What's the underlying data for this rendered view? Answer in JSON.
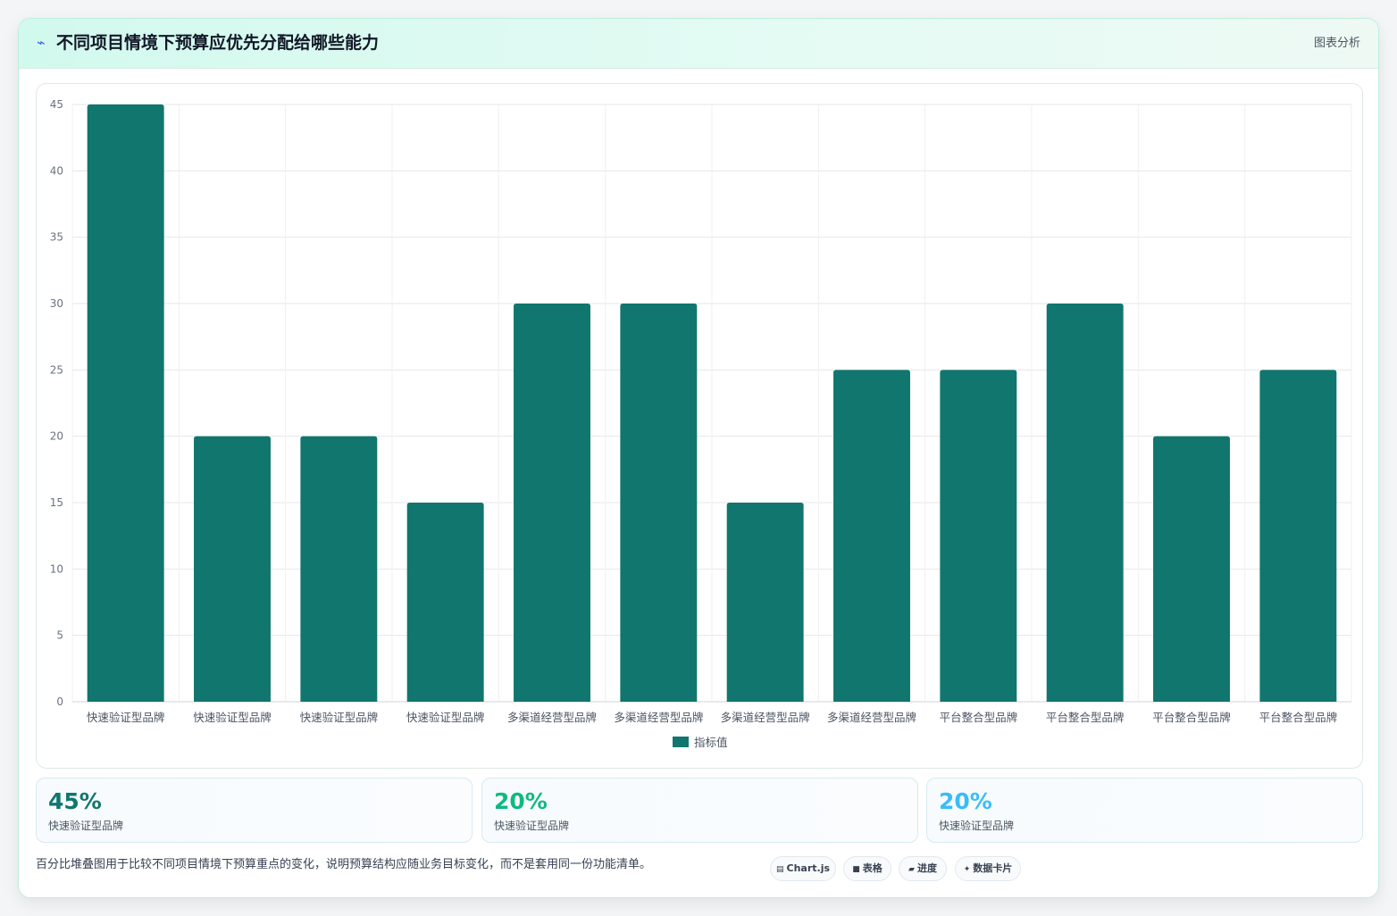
{
  "header": {
    "title": "不同项目情境下预算应优先分配给哪些能力",
    "tag": "图表分析"
  },
  "chart_data": {
    "type": "bar",
    "categories": [
      "快速验证型品牌",
      "快速验证型品牌",
      "快速验证型品牌",
      "快速验证型品牌",
      "多渠道经营型品牌",
      "多渠道经营型品牌",
      "多渠道经营型品牌",
      "多渠道经营型品牌",
      "平台整合型品牌",
      "平台整合型品牌",
      "平台整合型品牌",
      "平台整合型品牌"
    ],
    "series": [
      {
        "name": "指标值",
        "values": [
          45,
          20,
          20,
          15,
          30,
          30,
          15,
          25,
          25,
          30,
          20,
          25
        ],
        "color": "#10766e"
      }
    ],
    "ylim": [
      0,
      45
    ],
    "yticks": [
      0,
      5,
      10,
      15,
      20,
      25,
      30,
      35,
      40,
      45
    ],
    "grid": true,
    "legend": "bottom"
  },
  "stats": [
    {
      "value": "45%",
      "label": "快速验证型品牌",
      "color": "#10766e"
    },
    {
      "value": "20%",
      "label": "快速验证型品牌",
      "color": "#10b981"
    },
    {
      "value": "20%",
      "label": "快速验证型品牌",
      "color": "#38bdf8"
    }
  ],
  "footer": {
    "note": "百分比堆叠图用于比较不同项目情境下预算重点的变化，说明预算结构应随业务目标变化，而不是套用同一份功能清单。",
    "pills": [
      {
        "icon": "▤",
        "label": "Chart.js"
      },
      {
        "icon": "■",
        "label": "表格"
      },
      {
        "icon": "▰",
        "label": "进度"
      },
      {
        "icon": "✦",
        "label": "数据卡片"
      }
    ]
  }
}
